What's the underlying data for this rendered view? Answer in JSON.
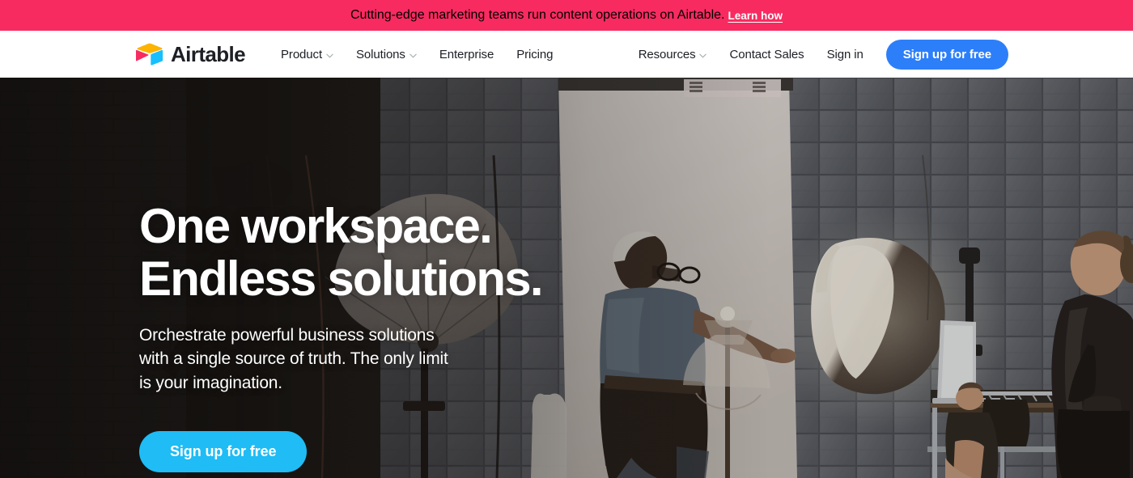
{
  "announcement": {
    "text": "Cutting-edge marketing teams run content operations on Airtable.",
    "link_label": "Learn how",
    "background_color": "#f82b60",
    "text_color": "#ffffff"
  },
  "navbar": {
    "logo_text": "Airtable",
    "logo_icon": "airtable-logo-icon",
    "left_items": [
      {
        "label": "Product",
        "has_dropdown": true
      },
      {
        "label": "Solutions",
        "has_dropdown": true
      },
      {
        "label": "Enterprise",
        "has_dropdown": false
      },
      {
        "label": "Pricing",
        "has_dropdown": false
      }
    ],
    "right_items": [
      {
        "label": "Resources",
        "has_dropdown": true
      },
      {
        "label": "Contact Sales",
        "has_dropdown": false
      },
      {
        "label": "Sign in",
        "has_dropdown": false
      }
    ],
    "cta_label": "Sign up for free",
    "cta_color": "#2d7ff9"
  },
  "hero": {
    "title_line1": "One workspace.",
    "title_line2": "Endless solutions.",
    "subtitle": "Orchestrate powerful business solutions with a single source of truth. The only limit is your imagination.",
    "cta_label": "Sign up for free",
    "cta_color": "#1fbcf5",
    "background_image_description": "Photography studio behind-the-scenes: tiled grey wall, softbox and umbrella lights on stands, a man in a blue t-shirt with glasses adjusting a white backdrop, and a woman in a black leather jacket working at a laptop on a rolling cart"
  }
}
